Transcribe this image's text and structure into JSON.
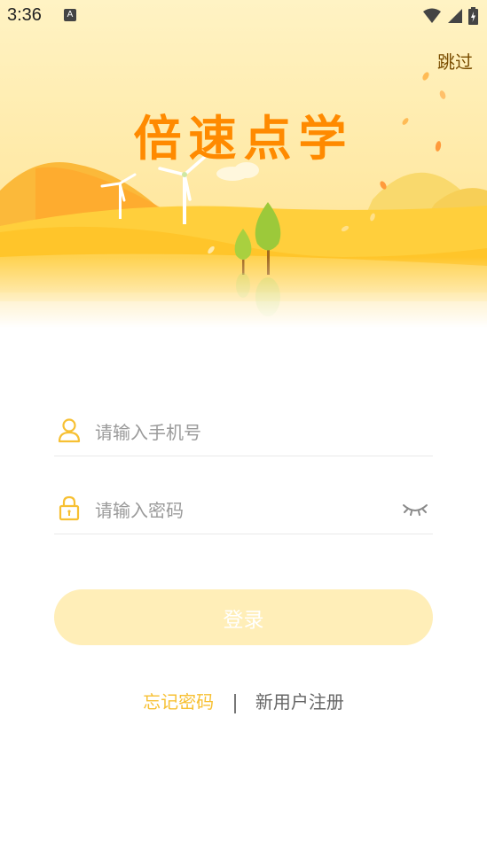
{
  "status_bar": {
    "time": "3:36",
    "notification_badge": "A",
    "icons": [
      "wifi-icon",
      "signal-icon",
      "battery-charging-icon"
    ]
  },
  "header": {
    "skip_label": "跳过",
    "app_title": "倍速点学"
  },
  "form": {
    "phone": {
      "placeholder": "请输入手机号",
      "value": ""
    },
    "password": {
      "placeholder": "请输入密码",
      "value": ""
    },
    "login_label": "登录"
  },
  "links": {
    "forgot_password": "忘记密码",
    "register": "新用户注册"
  },
  "colors": {
    "accent": "#f7c033",
    "title": "#ff8a00",
    "button_disabled": "#ffeeb8"
  }
}
